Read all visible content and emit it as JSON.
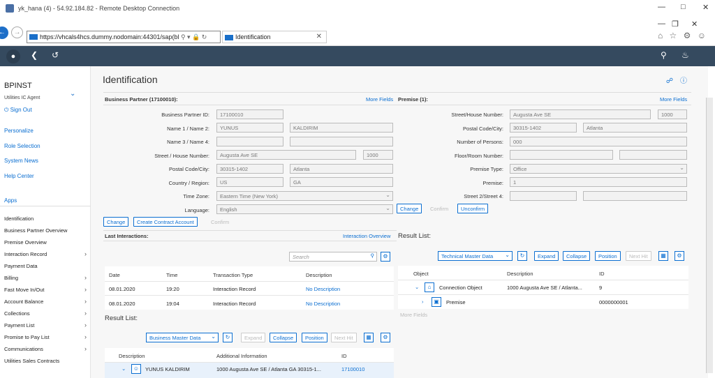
{
  "rdp": {
    "title": "yk_hana (4) - 54.92.184.82 - Remote Desktop Connection"
  },
  "browser": {
    "url": "https://vhcals4hcs.dummy.nodomain:44301/sap(bl",
    "tab_title": "Identification"
  },
  "sidebar": {
    "user": "BPINST",
    "role": "Utilities IC Agent",
    "sign_out": "Sign Out",
    "links": [
      "Personalize",
      "Role Selection",
      "System News",
      "Help Center"
    ],
    "apps_label": "Apps",
    "apps": [
      {
        "label": "Identification",
        "arrow": false
      },
      {
        "label": "Business Partner Overview",
        "arrow": false
      },
      {
        "label": "Premise Overview",
        "arrow": false
      },
      {
        "label": "Interaction Record",
        "arrow": true
      },
      {
        "label": "Payment Data",
        "arrow": false
      },
      {
        "label": "Billing",
        "arrow": true
      },
      {
        "label": "Fast Move In/Out",
        "arrow": true
      },
      {
        "label": "Account Balance",
        "arrow": true
      },
      {
        "label": "Collections",
        "arrow": true
      },
      {
        "label": "Payment List",
        "arrow": true
      },
      {
        "label": "Promise to Pay List",
        "arrow": true
      },
      {
        "label": "Communications",
        "arrow": true
      },
      {
        "label": "Utilities Sales Contracts",
        "arrow": false
      }
    ]
  },
  "page": {
    "title": "Identification"
  },
  "bp": {
    "header": "Business Partner (17100010):",
    "more_fields": "More Fields",
    "labels": {
      "id": "Business Partner ID:",
      "name12": "Name 1 / Name 2:",
      "name34": "Name 3 / Name 4:",
      "street": "Street / House Number:",
      "postal": "Postal Code/City:",
      "country": "Country / Region:",
      "tz": "Time Zone:",
      "lang": "Language:"
    },
    "values": {
      "id": "17100010",
      "name1": "YUNUS",
      "name2": "KALDIRIM",
      "street": "Augusta Ave SE",
      "house": "1000",
      "postal": "30315-1402",
      "city": "Atlanta",
      "country": "US",
      "region": "GA",
      "tz": "Eastern Time (New York)",
      "lang": "English"
    },
    "buttons": {
      "change": "Change",
      "create_contract": "Create Contract Account",
      "confirm": "Confirm"
    }
  },
  "premise": {
    "header": "Premise (1):",
    "more_fields": "More Fields",
    "labels": {
      "street": "Street/House Number:",
      "postal": "Postal Code/City:",
      "persons": "Number of Persons:",
      "floor": "Floor/Room Number:",
      "type": "Premise Type:",
      "premise": "Premise:",
      "street24": "Street 2/Street 4:"
    },
    "values": {
      "street": "Augusta Ave SE",
      "house": "1000",
      "postal": "30315-1402",
      "city": "Atlanta",
      "persons": "000",
      "type": "Office",
      "premise": "1"
    },
    "buttons": {
      "change": "Change",
      "confirm": "Confirm",
      "unconfirm": "Unconfirm"
    }
  },
  "interactions": {
    "header": "Last Interactions:",
    "overview_link": "Interaction Overview",
    "search_placeholder": "Search",
    "columns": [
      "Date",
      "Time",
      "Transaction Type",
      "Description"
    ],
    "rows": [
      {
        "date": "08.01.2020",
        "time": "19:20",
        "type": "Interaction  Record",
        "desc": "No Description"
      },
      {
        "date": "08.01.2020",
        "time": "19:04",
        "type": "Interaction  Record",
        "desc": "No Description"
      }
    ]
  },
  "result_right": {
    "header": "Result List:",
    "dropdown": "Technical Master Data",
    "buttons": {
      "expand": "Expand",
      "collapse": "Collapse",
      "position": "Position",
      "next_hit": "Next Hit"
    },
    "columns": [
      "Object",
      "Description",
      "ID"
    ],
    "rows": [
      {
        "object": "Connection Object",
        "desc": "1000 Augusta Ave SE / Atlanta...",
        "id": "9"
      },
      {
        "object": "Premise",
        "desc": "",
        "id": "0000000001"
      }
    ],
    "more_fields": "More Fields"
  },
  "result_left": {
    "header": "Result List:",
    "dropdown": "Business Master Data",
    "buttons": {
      "expand": "Expand",
      "collapse": "Collapse",
      "position": "Position",
      "next_hit": "Next Hit"
    },
    "columns": [
      "Description",
      "Additional Information",
      "ID"
    ],
    "rows": [
      {
        "desc": "YUNUS KALDIRIM",
        "info": "1000 Augusta Ave SE / Atlanta GA 30315-1...",
        "id": "17100010"
      }
    ]
  }
}
